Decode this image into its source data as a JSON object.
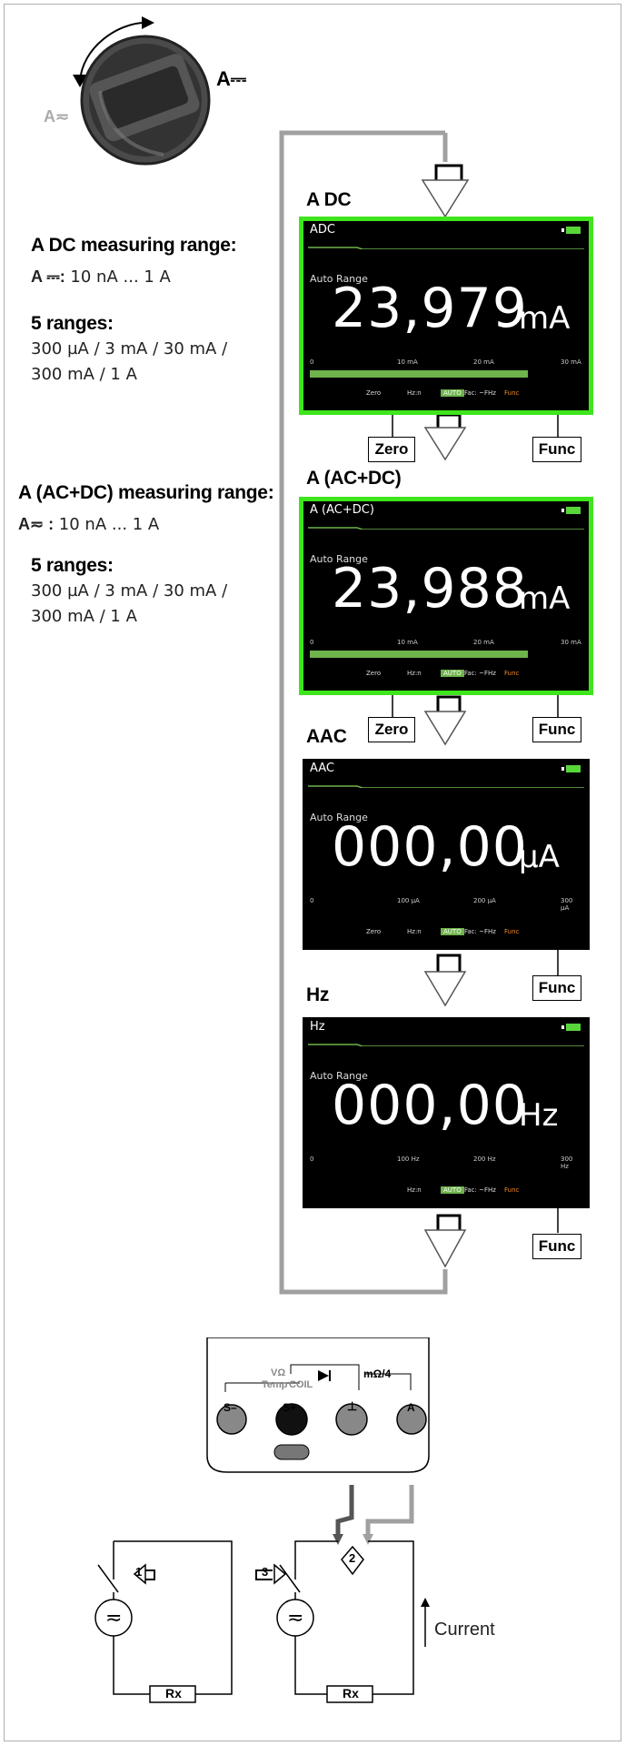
{
  "rotary": {
    "position_label": "A⎓",
    "alt_label": "A≂"
  },
  "sections": {
    "dc": {
      "heading": "A DC measuring range:",
      "range_symbol": "A ⎓:",
      "range_value": " 10 nA ... 1 A",
      "ranges_heading": "5 ranges:",
      "ranges_line1": "300 µA / 3 mA / 30 mA /",
      "ranges_line2": "300 mA / 1 A"
    },
    "acdc": {
      "heading": "A (AC+DC) measuring range:",
      "range_symbol": "A≂ :",
      "range_value": " 10 nA ... 1 A",
      "ranges_heading": "5 ranges:",
      "ranges_line1": "300 µA / 3 mA / 30 mA /",
      "ranges_line2": "300 mA / 1 A"
    }
  },
  "screens": [
    {
      "label": "A DC",
      "title": "ADC",
      "auto": "Auto Range",
      "value": "23,979",
      "unit": "mA",
      "scale": [
        "0",
        "10 mA",
        "20 mA",
        "30 mA"
      ],
      "bar_fraction": 0.8,
      "softkeys": [
        "Zero",
        "Hz:n",
        "AUTO",
        "Fac: ~FHz",
        "Func"
      ],
      "highlighted": true
    },
    {
      "label": "A (AC+DC)",
      "title": "A (AC+DC)",
      "auto": "Auto Range",
      "value": "23,988",
      "unit": "mA",
      "scale": [
        "0",
        "10 mA",
        "20 mA",
        "30 mA"
      ],
      "bar_fraction": 0.8,
      "softkeys": [
        "Zero",
        "Hz:n",
        "AUTO",
        "Fac: ~FHz",
        "Func"
      ],
      "highlighted": true
    },
    {
      "label": "AAC",
      "title": "AAC",
      "auto": "Auto Range",
      "value": "000,00",
      "unit": "µA",
      "scale": [
        "0",
        "100 µA",
        "200 µA",
        "300 µA"
      ],
      "bar_fraction": 0,
      "softkeys": [
        "Zero",
        "Hz:n",
        "AUTO",
        "Fac: ~FHz",
        "Func"
      ],
      "highlighted": false
    },
    {
      "label": "Hz",
      "title": "Hz",
      "auto": "Auto Range",
      "value": "000,00",
      "unit": "Hz",
      "scale": [
        "0",
        "100 Hz",
        "200 Hz",
        "300 Hz"
      ],
      "bar_fraction": 0,
      "softkeys": [
        "",
        "Hz:n",
        "AUTO",
        "Fac: ~FHz",
        "Func"
      ],
      "highlighted": false
    }
  ],
  "buttons": {
    "zero": "Zero",
    "func": "Func"
  },
  "sockets": {
    "s_minus": "S–",
    "s_plus": "S+",
    "ground": "⊥",
    "amp": "A",
    "label_v": "VΩ",
    "label_temp": "Temp",
    "label_coil": "COIL",
    "label_mohm": "mΩ/4"
  },
  "circuit": {
    "rx1": "Rx",
    "rx2": "Rx",
    "step1": "1",
    "step2": "2",
    "step3": "3",
    "current": "Current",
    "source_symbol": "≂"
  },
  "colors": {
    "highlight": "#3ee51c",
    "bar": "#6eb34b",
    "flow_line": "#a0a0a0"
  }
}
